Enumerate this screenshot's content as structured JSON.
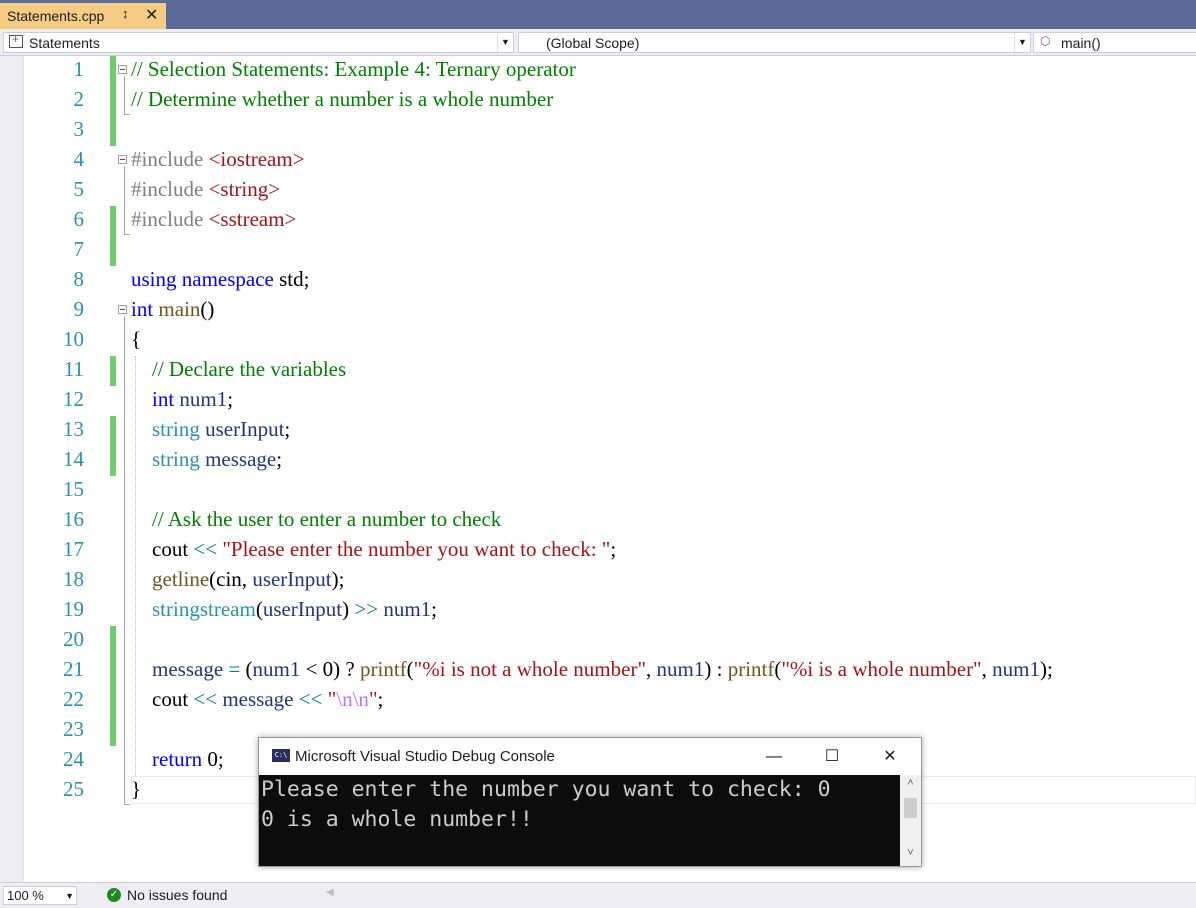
{
  "tab": {
    "title": "Statements.cpp",
    "pin_icon": "pin-icon",
    "close_icon": "close-icon"
  },
  "navbar": {
    "project": "Statements",
    "scope": "(Global Scope)",
    "member": "main()"
  },
  "editor": {
    "lines": [
      {
        "n": "1",
        "tokens": [
          {
            "t": "// Selection Statements: Example 4: Ternary operator",
            "c": "cmt"
          }
        ]
      },
      {
        "n": "2",
        "tokens": [
          {
            "t": "// Determine whether a number is a whole number",
            "c": "cmt"
          }
        ]
      },
      {
        "n": "3",
        "tokens": []
      },
      {
        "n": "4",
        "tokens": [
          {
            "t": "#include ",
            "c": "pp"
          },
          {
            "t": "<iostream>",
            "c": "str"
          }
        ]
      },
      {
        "n": "5",
        "tokens": [
          {
            "t": "#include ",
            "c": "pp"
          },
          {
            "t": "<string>",
            "c": "str"
          }
        ]
      },
      {
        "n": "6",
        "tokens": [
          {
            "t": "#include ",
            "c": "pp"
          },
          {
            "t": "<sstream>",
            "c": "str"
          }
        ]
      },
      {
        "n": "7",
        "tokens": []
      },
      {
        "n": "8",
        "tokens": [
          {
            "t": "using namespace ",
            "c": "kw"
          },
          {
            "t": "std;",
            "c": ""
          }
        ]
      },
      {
        "n": "9",
        "tokens": [
          {
            "t": "int ",
            "c": "kw"
          },
          {
            "t": "main",
            "c": "fn"
          },
          {
            "t": "()",
            "c": ""
          }
        ]
      },
      {
        "n": "10",
        "tokens": [
          {
            "t": "{",
            "c": ""
          }
        ]
      },
      {
        "n": "11",
        "tokens": [
          {
            "t": "    // Declare the variables",
            "c": "cmt"
          }
        ]
      },
      {
        "n": "12",
        "tokens": [
          {
            "t": "    int ",
            "c": "kw"
          },
          {
            "t": "num1",
            "c": "var"
          },
          {
            "t": ";",
            "c": ""
          }
        ]
      },
      {
        "n": "13",
        "tokens": [
          {
            "t": "    string ",
            "c": "type"
          },
          {
            "t": "userInput",
            "c": "var"
          },
          {
            "t": ";",
            "c": ""
          }
        ]
      },
      {
        "n": "14",
        "tokens": [
          {
            "t": "    string ",
            "c": "type"
          },
          {
            "t": "message",
            "c": "var"
          },
          {
            "t": ";",
            "c": ""
          }
        ]
      },
      {
        "n": "15",
        "tokens": []
      },
      {
        "n": "16",
        "tokens": [
          {
            "t": "    // Ask the user to enter a number to check",
            "c": "cmt"
          }
        ]
      },
      {
        "n": "17",
        "tokens": [
          {
            "t": "    cout ",
            "c": ""
          },
          {
            "t": "<< ",
            "c": "op"
          },
          {
            "t": "\"Please enter the number you want to check: \"",
            "c": "str"
          },
          {
            "t": ";",
            "c": ""
          }
        ]
      },
      {
        "n": "18",
        "tokens": [
          {
            "t": "    getline",
            "c": "fn"
          },
          {
            "t": "(cin, ",
            "c": ""
          },
          {
            "t": "userInput",
            "c": "var"
          },
          {
            "t": ");",
            "c": ""
          }
        ]
      },
      {
        "n": "19",
        "tokens": [
          {
            "t": "    stringstream",
            "c": "type"
          },
          {
            "t": "(",
            "c": ""
          },
          {
            "t": "userInput",
            "c": "var"
          },
          {
            "t": ") ",
            "c": ""
          },
          {
            "t": ">> ",
            "c": "op"
          },
          {
            "t": "num1",
            "c": "var"
          },
          {
            "t": ";",
            "c": ""
          }
        ]
      },
      {
        "n": "20",
        "tokens": []
      },
      {
        "n": "21",
        "tokens": [
          {
            "t": "    message ",
            "c": "var"
          },
          {
            "t": "= ",
            "c": "op"
          },
          {
            "t": "(",
            "c": ""
          },
          {
            "t": "num1",
            "c": "var"
          },
          {
            "t": " < 0) ? ",
            "c": ""
          },
          {
            "t": "printf",
            "c": "fn"
          },
          {
            "t": "(",
            "c": ""
          },
          {
            "t": "\"%i is not a whole number\"",
            "c": "str"
          },
          {
            "t": ", ",
            "c": ""
          },
          {
            "t": "num1",
            "c": "var"
          },
          {
            "t": ") : ",
            "c": ""
          },
          {
            "t": "printf",
            "c": "fn"
          },
          {
            "t": "(",
            "c": ""
          },
          {
            "t": "\"%i is a whole number\"",
            "c": "str"
          },
          {
            "t": ", ",
            "c": ""
          },
          {
            "t": "num1",
            "c": "var"
          },
          {
            "t": ");",
            "c": ""
          }
        ]
      },
      {
        "n": "22",
        "tokens": [
          {
            "t": "    cout ",
            "c": ""
          },
          {
            "t": "<< ",
            "c": "op"
          },
          {
            "t": "message ",
            "c": "var"
          },
          {
            "t": "<< ",
            "c": "op"
          },
          {
            "t": "\"",
            "c": "str"
          },
          {
            "t": "\\n\\n",
            "c": "esc"
          },
          {
            "t": "\"",
            "c": "str"
          },
          {
            "t": ";",
            "c": ""
          }
        ]
      },
      {
        "n": "23",
        "tokens": []
      },
      {
        "n": "24",
        "tokens": [
          {
            "t": "    return ",
            "c": "kw"
          },
          {
            "t": "0;",
            "c": ""
          }
        ]
      },
      {
        "n": "25",
        "tokens": [
          {
            "t": "}",
            "c": ""
          }
        ]
      }
    ],
    "changed_lines": [
      "1",
      "2",
      "3",
      "6",
      "7",
      "11",
      "13",
      "14",
      "20",
      "21",
      "22",
      "23"
    ],
    "fold_lines": [
      "1",
      "4",
      "9"
    ]
  },
  "statusbar": {
    "zoom": "100 %",
    "issues": "No issues found"
  },
  "console": {
    "title": "Microsoft Visual Studio Debug Console",
    "icon_label": "C:\\",
    "minimize": "—",
    "maximize": "☐",
    "close": "✕",
    "output": [
      "Please enter the number you want to check: 0",
      "0 is a whole number!!"
    ]
  },
  "colors": {
    "comment": "#008000",
    "preprocessor": "#808080",
    "string": "#a31515",
    "keyword": "#0000ff",
    "type": "#2b91af",
    "function": "#74531f",
    "variable": "#1f377f",
    "escape": "#b776fb",
    "tab_active": "#f5cc84",
    "tab_strip": "#5d6b99",
    "change_marker": "#6fcc6f"
  }
}
